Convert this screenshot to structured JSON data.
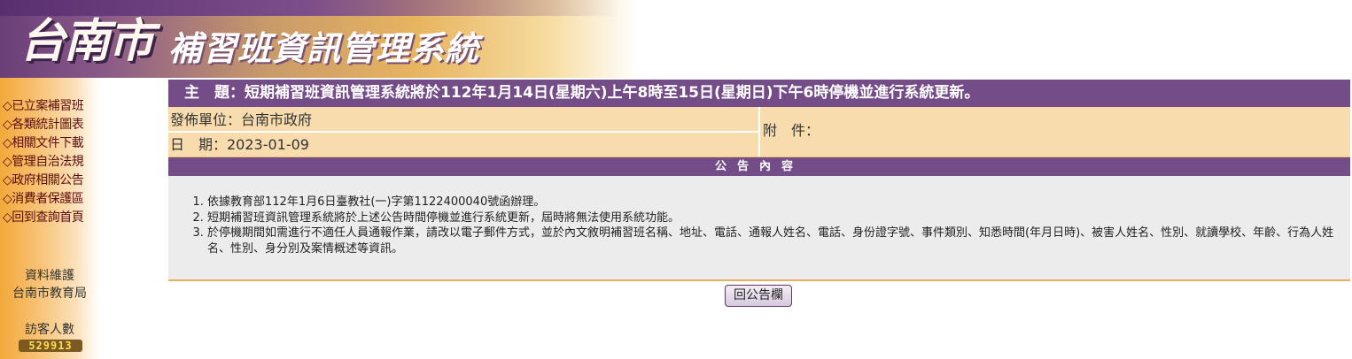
{
  "header": {
    "city": "台南市",
    "system": "補習班資訊管理系統"
  },
  "sidebar": {
    "items": [
      {
        "label": "◇已立案補習班"
      },
      {
        "label": "◇各類統計圖表"
      },
      {
        "label": "◇相關文件下載"
      },
      {
        "label": "◇管理自治法規"
      },
      {
        "label": "◇政府相關公告"
      },
      {
        "label": "◇消費者保護區"
      },
      {
        "label": "◇回到查詢首頁"
      }
    ],
    "maintenance_label": "資料維護",
    "maintenance_org": "台南市教育局",
    "visitor_label": "訪客人數",
    "visitor_count": "529913"
  },
  "announcement": {
    "subject": "主　題：短期補習班資訊管理系統將於112年1月14日(星期六)上午8時至15日(星期日)下午6時停機並進行系統更新。",
    "issuer": "發佈單位：台南市政府",
    "date": "日　期：2023-01-09",
    "attachment": "附　件：",
    "content_header": "公告內容",
    "items": [
      "依據教育部112年1月6日臺教社(一)字第1122400040號函辦理。",
      "短期補習班資訊管理系統將於上述公告時間停機並進行系統更新，屆時將無法使用系統功能。",
      "於停機期間如需進行不適任人員通報作業，請改以電子郵件方式，並於內文敘明補習班名稱、地址、電話、通報人姓名、電話、身份證字號、事件類別、知悉時間(年月日時)、被害人姓名、性別、就讀學校、年齡、行為人姓名、性別、身分別及案情概述等資訊。"
    ],
    "back_button": "回公告欄"
  }
}
